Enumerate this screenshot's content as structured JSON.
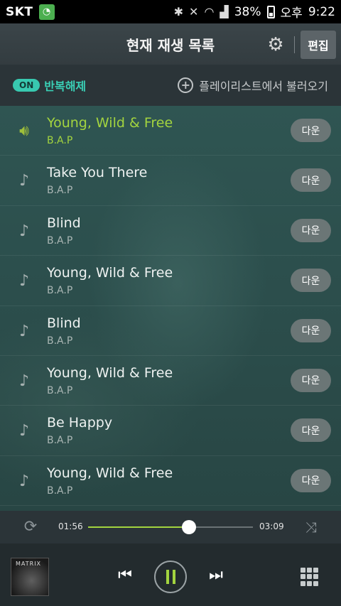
{
  "statusbar": {
    "carrier": "SKT",
    "battery": "38%",
    "ampm": "오후",
    "time": "9:22"
  },
  "header": {
    "title": "현재 재생 목록",
    "edit_label": "편집"
  },
  "options": {
    "on_label": "ON",
    "repeat_label": "반복해제",
    "load_label": "플레이리스트에서 불러오기"
  },
  "tracks": [
    {
      "title": "Young, Wild & Free",
      "artist": "B.A.P",
      "download": "다운",
      "playing": true
    },
    {
      "title": "Take You There",
      "artist": "B.A.P",
      "download": "다운",
      "playing": false
    },
    {
      "title": "Blind",
      "artist": "B.A.P",
      "download": "다운",
      "playing": false
    },
    {
      "title": "Young, Wild & Free",
      "artist": "B.A.P",
      "download": "다운",
      "playing": false
    },
    {
      "title": "Blind",
      "artist": "B.A.P",
      "download": "다운",
      "playing": false
    },
    {
      "title": "Young, Wild & Free",
      "artist": "B.A.P",
      "download": "다운",
      "playing": false
    },
    {
      "title": "Be Happy",
      "artist": "B.A.P",
      "download": "다운",
      "playing": false
    },
    {
      "title": "Young, Wild & Free",
      "artist": "B.A.P",
      "download": "다운",
      "playing": false
    }
  ],
  "player": {
    "current_time": "01:56",
    "total_time": "03:09",
    "progress": 0.61,
    "album_label": "MATRIX"
  },
  "colors": {
    "accent": "#a3d43f",
    "on_badge": "#38c9b0"
  }
}
